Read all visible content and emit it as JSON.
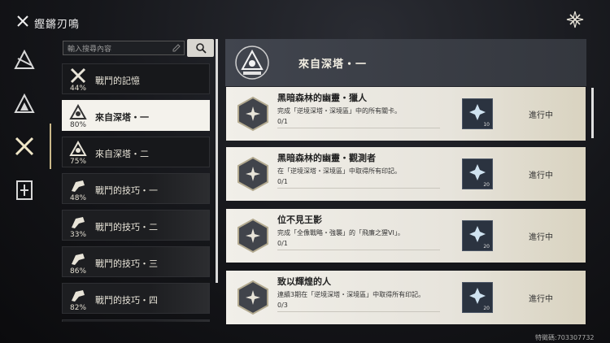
{
  "app": {
    "title": "鏗鏘刃鳴"
  },
  "search": {
    "placeholder": "輸入搜尋內容"
  },
  "nav": {
    "items": [
      {
        "icon": "triangle-slash-icon"
      },
      {
        "icon": "triangle-icon"
      },
      {
        "icon": "crossed-swords-icon",
        "active": true
      },
      {
        "icon": "book-icon"
      }
    ]
  },
  "categories": [
    {
      "label": "戰鬥的記憶",
      "percent": "44%",
      "icon": "crossed-swords-icon"
    },
    {
      "label": "來自深塔・一",
      "percent": "80%",
      "icon": "tower-triangle-icon",
      "active": true
    },
    {
      "label": "來自深塔・二",
      "percent": "75%",
      "icon": "tower-triangle-icon"
    },
    {
      "label": "戰鬥的技巧・一",
      "percent": "48%",
      "icon": "fist-icon"
    },
    {
      "label": "戰鬥的技巧・二",
      "percent": "33%",
      "icon": "fist-icon"
    },
    {
      "label": "戰鬥的技巧・三",
      "percent": "86%",
      "icon": "fist-icon"
    },
    {
      "label": "戰鬥的技巧・四",
      "percent": "82%",
      "icon": "fist-icon"
    }
  ],
  "panel": {
    "title": "來自深塔・一"
  },
  "achievements": [
    {
      "name": "黑暗森林的幽靈・獵人",
      "desc": "完成「逆境深塔・深境區」中的所有關卡。",
      "progress": "0/1",
      "reward_count": "10",
      "status": "進行中"
    },
    {
      "name": "黑暗森林的幽靈・觀測者",
      "desc": "在「逆境深塔・深境區」中取得所有印記。",
      "progress": "0/1",
      "reward_count": "20",
      "status": "進行中"
    },
    {
      "name": "位不見王影",
      "desc": "完成「全像戰略・強襲」的「飛廉之猩VI」。",
      "progress": "0/1",
      "reward_count": "20",
      "status": "進行中"
    },
    {
      "name": "致以輝煌的人",
      "desc": "連續3期在「逆境深塔・深境區」中取得所有印記。",
      "progress": "0/3",
      "reward_count": "20",
      "status": "進行中"
    }
  ],
  "watermark": "特徵碼:703307732",
  "colors": {
    "accent": "#cbb98a",
    "card": "#f1efe9",
    "dark": "#17181b"
  }
}
